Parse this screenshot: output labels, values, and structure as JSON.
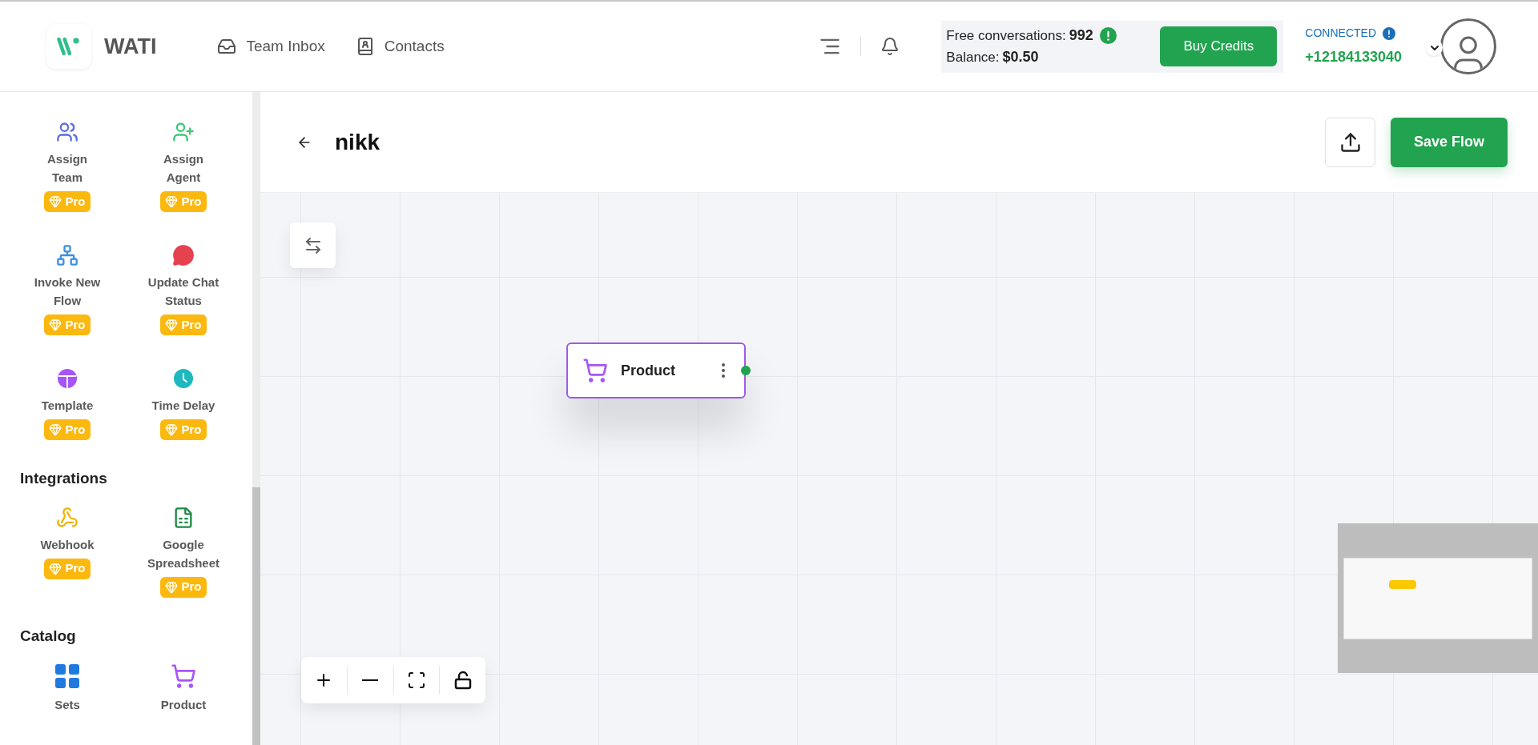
{
  "header": {
    "brand": "WATI",
    "nav": [
      {
        "label": "Team Inbox",
        "kind": "inbox"
      },
      {
        "label": "Contacts",
        "kind": "contacts"
      }
    ],
    "credits": {
      "free_label": "Free conversations:",
      "free_value": "992",
      "balance_label": "Balance:",
      "balance_value": "$0.50",
      "button": "Buy Credits"
    },
    "connection": {
      "status": "CONNECTED",
      "phone": "+12184133040"
    }
  },
  "sidebar": {
    "sections": [
      {
        "items": [
          {
            "label": "Assign Team",
            "kind": "team",
            "badge": "Pro"
          },
          {
            "label": "Assign Agent",
            "kind": "agent",
            "badge": "Pro"
          },
          {
            "label": "Invoke New Flow",
            "kind": "flow",
            "badge": "Pro"
          },
          {
            "label": "Update Chat Status",
            "kind": "chat-status",
            "badge": "Pro"
          },
          {
            "label": "Template",
            "kind": "template",
            "badge": "Pro"
          },
          {
            "label": "Time Delay",
            "kind": "delay",
            "badge": "Pro"
          }
        ]
      },
      {
        "title": "Integrations",
        "items": [
          {
            "label": "Webhook",
            "kind": "webhook",
            "badge": "Pro"
          },
          {
            "label": "Google Spreadsheet",
            "kind": "spreadsheet",
            "badge": "Pro"
          }
        ]
      },
      {
        "title": "Catalog",
        "items": [
          {
            "label": "Sets",
            "kind": "sets"
          },
          {
            "label": "Product",
            "kind": "product"
          }
        ]
      }
    ]
  },
  "flow": {
    "title": "nikk",
    "save_button": "Save Flow"
  },
  "canvas": {
    "nodes": [
      {
        "label": "Product",
        "kind": "product"
      }
    ]
  }
}
